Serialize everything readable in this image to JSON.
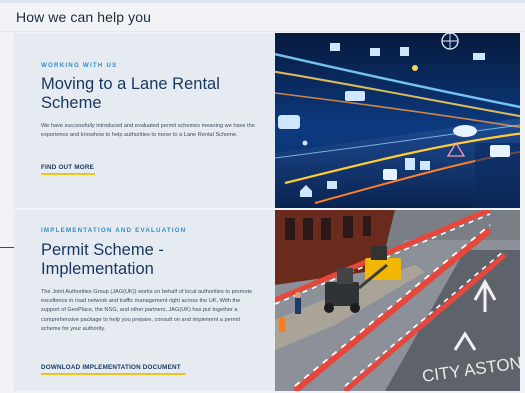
{
  "section": {
    "heading": "How we can help you"
  },
  "cards": [
    {
      "eyebrow": "WORKING WITH US",
      "title": "Moving to a Lane Rental Scheme",
      "description": "We have successfully introduced and evaluated permit schemes meaning we have the experience and knowhow to help authorities to move to a Lane Rental Scheme.",
      "link": "FIND OUT MORE",
      "image": "smart-city-traffic-image"
    },
    {
      "eyebrow": "IMPLEMENTATION AND EVALUATION",
      "title": "Permit Scheme - Implementation",
      "description": "The Joint Authorities Group (JAG(UK)) works on behalf of local authorities to promote excellence in road network and traffic management right across the UK. With the support of GeoPlace, the NSG, and other partners, JAG(UK) has put together a comprehensive package to help you prepare, consult on and implement a permit scheme for your authority.",
      "link": "DOWNLOAD IMPLEMENTATION DOCUMENT",
      "image": "roadworks-image",
      "road_marking": "CITY ASTON"
    }
  ],
  "colors": {
    "accent_blue": "#2f8dc7",
    "title_navy": "#17375e",
    "link_underline": "#f1c21b",
    "card_background": "#e6ebf2"
  }
}
